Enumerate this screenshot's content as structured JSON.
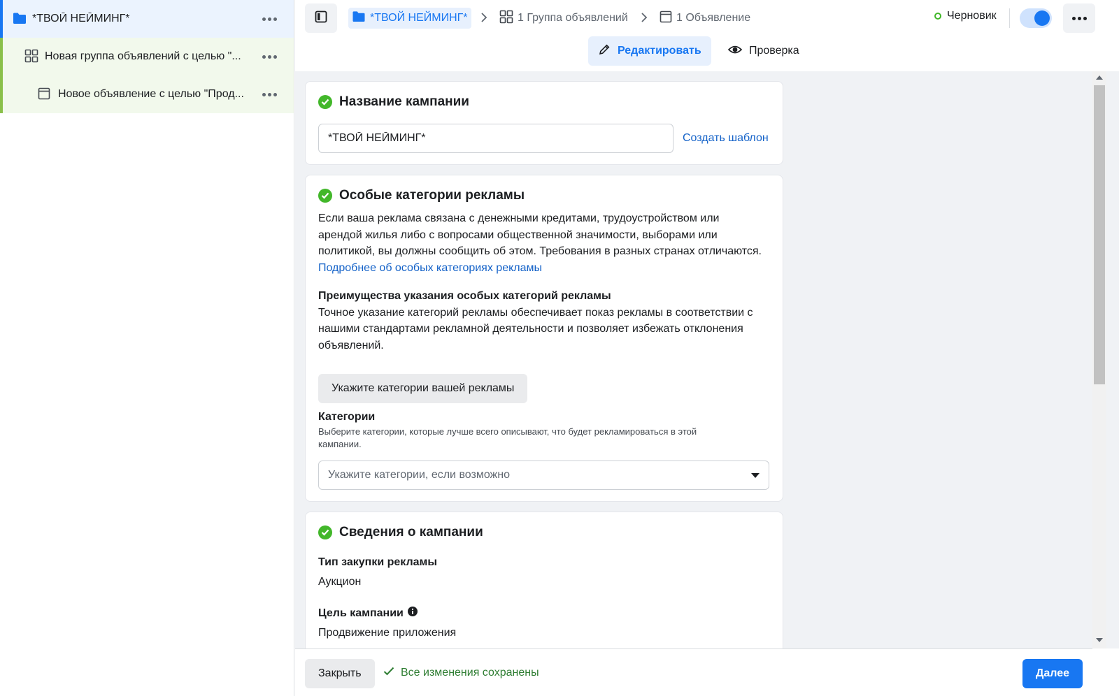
{
  "colors": {
    "accent": "#1877f2",
    "success": "#42b72a",
    "adset_bar": "#8ac04a"
  },
  "sidebar": {
    "campaign": {
      "label": "*ТВОЙ НЕЙМИНГ*",
      "icon": "folder-icon"
    },
    "adset": {
      "label": "Новая группа объявлений с целью \"...",
      "icon": "grid-icon"
    },
    "ad": {
      "label": "Новое объявление с целью \"Прод...",
      "icon": "ad-window-icon"
    }
  },
  "topbar": {
    "breadcrumbs": [
      {
        "label": "*ТВОЙ НЕЙМИНГ*",
        "icon": "folder-icon"
      },
      {
        "label": "1 Группа объявлений",
        "icon": "grid-icon"
      },
      {
        "label": "1 Объявление",
        "icon": "ad-window-icon"
      }
    ],
    "status": "Черновик",
    "toggle_on": true,
    "tabs": {
      "edit": "Редактировать",
      "review": "Проверка"
    }
  },
  "campaign_name": {
    "title": "Название кампании",
    "value": "*ТВОЙ НЕЙМИНГ*",
    "create_template": "Создать шаблон"
  },
  "special_categories": {
    "title": "Особые категории рекламы",
    "desc_lines": [
      "Если ваша реклама связана с денежными кредитами, трудоустройством или",
      "арендой жилья либо с вопросами общественной значимости, выборами или",
      "политикой, вы должны сообщить об этом. Требования в разных странах отличаются."
    ],
    "learn_more": "Подробнее об особых категориях рекламы",
    "benefits_title": "Преимущества указания особых категорий рекламы",
    "benefits_lines": [
      "Точное указание категорий рекламы обеспечивает показ рекламы в соответствии с",
      "нашими стандартами рекламной деятельности и позволяет избежать отклонения",
      "объявлений."
    ],
    "specify_button": "Укажите категории вашей рекламы",
    "categories_label": "Категории",
    "categories_hint_lines": [
      "Выберите категории, которые лучше всего описывают, что будет рекламироваться в этой",
      "кампании."
    ],
    "select_placeholder": "Укажите категории, если возможно"
  },
  "campaign_details": {
    "title": "Сведения о кампании",
    "buying_type_label": "Тип закупки рекламы",
    "buying_type_value": "Аукцион",
    "objective_label": "Цель кампании",
    "objective_value": "Продвижение приложения"
  },
  "footer": {
    "close": "Закрыть",
    "saved": "Все изменения сохранены",
    "next": "Далее"
  }
}
